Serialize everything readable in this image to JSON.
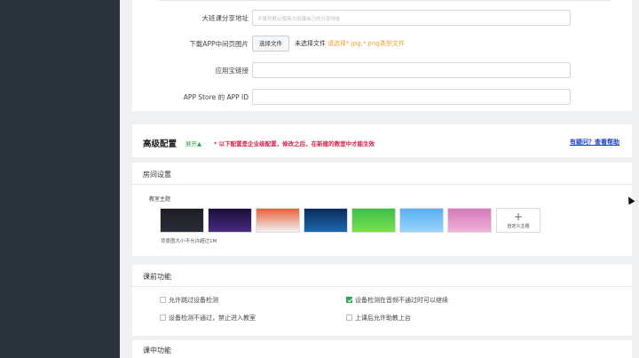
{
  "share_form": {
    "class_share_url": {
      "label": "大班课分享地址",
      "placeholder": "不填写默认使用大班课自己的分享地址"
    },
    "download_image": {
      "label": "下载APP中间页图片",
      "button": "选择文件",
      "no_file": "未选择文件",
      "hint": "请选择*.jpg,*.png类型文件"
    },
    "app_store_link": {
      "label": "应用宝链接"
    },
    "app_store_id": {
      "label": "APP Store 的 APP ID"
    }
  },
  "advanced": {
    "title": "高级配置",
    "expand": "展开▲",
    "note": "* 以下配置是企业级配置，修改之后，在新建的教室中才能生效",
    "help": "有疑问？查看帮助"
  },
  "room_settings": {
    "title": "房间设置",
    "theme_label": "教室主题",
    "custom_theme": "自定义主题",
    "size_note": "背景图大小不允许超过1M",
    "themes": [
      {
        "name": "dark",
        "colors": [
          "#1e1f26",
          "#2a2c36"
        ]
      },
      {
        "name": "purple-space",
        "colors": [
          "#1a0f3a",
          "#4a2a80"
        ]
      },
      {
        "name": "sunset",
        "colors": [
          "#e8603a",
          "#f2f2f2"
        ]
      },
      {
        "name": "blue-stars",
        "colors": [
          "#0a2a5a",
          "#1a6ab0"
        ]
      },
      {
        "name": "green-circles",
        "colors": [
          "#3cc04a",
          "#7ae04a"
        ]
      },
      {
        "name": "sky-clouds",
        "colors": [
          "#58b0f0",
          "#9ad4ff"
        ]
      },
      {
        "name": "pink-garden",
        "colors": [
          "#d47ab8",
          "#f0b0d8"
        ]
      }
    ]
  },
  "pre_class": {
    "title": "课前功能",
    "options": [
      {
        "label": "允许跳过设备检测",
        "checked": false
      },
      {
        "label": "设备检测在音频不通过时可以继续",
        "checked": true
      },
      {
        "label": "设备检测不通过，禁止进入教室",
        "checked": false
      },
      {
        "label": "上课后允许助教上台",
        "checked": false
      }
    ]
  },
  "in_class": {
    "title": "课中功能"
  }
}
